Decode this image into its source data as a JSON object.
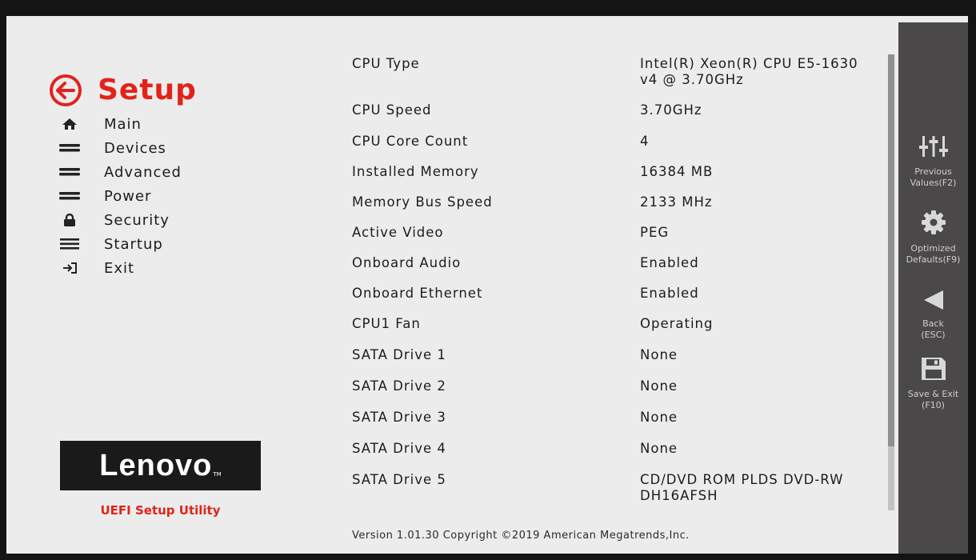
{
  "header": {
    "title": "Setup"
  },
  "nav": {
    "items": [
      {
        "label": "Main",
        "icon": "home-icon"
      },
      {
        "label": "Devices",
        "icon": "devices-icon"
      },
      {
        "label": "Advanced",
        "icon": "advanced-icon"
      },
      {
        "label": "Power",
        "icon": "power-icon"
      },
      {
        "label": "Security",
        "icon": "lock-icon"
      },
      {
        "label": "Startup",
        "icon": "startup-icon"
      },
      {
        "label": "Exit",
        "icon": "exit-icon"
      }
    ]
  },
  "brand": {
    "logo_text": "Lenovo",
    "logo_tm": "TM",
    "utility_label": "UEFI Setup Utility",
    "accent_color": "#e2231a"
  },
  "info": [
    {
      "label": "CPU Type",
      "value": "Intel(R) Xeon(R) CPU E5-1630 v4 @ 3.70GHz"
    },
    {
      "label": "CPU Speed",
      "value": "3.70GHz"
    },
    {
      "label": "CPU Core Count",
      "value": "4"
    },
    {
      "label": "Installed Memory",
      "value": "16384 MB"
    },
    {
      "label": "Memory Bus Speed",
      "value": "2133 MHz"
    },
    {
      "label": "Active Video",
      "value": "PEG"
    },
    {
      "label": "Onboard Audio",
      "value": "Enabled"
    },
    {
      "label": "Onboard Ethernet",
      "value": "Enabled"
    },
    {
      "label": "CPU1 Fan",
      "value": "Operating"
    },
    {
      "label": "SATA Drive 1",
      "value": "None"
    },
    {
      "label": "SATA Drive 2",
      "value": "None"
    },
    {
      "label": "SATA Drive 3",
      "value": "None"
    },
    {
      "label": "SATA Drive 4",
      "value": "None"
    },
    {
      "label": "SATA Drive 5",
      "value": "CD/DVD ROM PLDS DVD-RW DH16AFSH"
    }
  ],
  "footer": {
    "text": "Version 1.01.30 Copyright ©2019 American Megatrends,Inc."
  },
  "functions": [
    {
      "label": "Previous\nValues(F2)",
      "icon": "sliders-icon"
    },
    {
      "label": "Optimized\nDefaults(F9)",
      "icon": "gear-icon"
    },
    {
      "label": "Back\n(ESC)",
      "icon": "back-arrow-icon"
    },
    {
      "label": "Save & Exit\n(F10)",
      "icon": "save-icon"
    }
  ]
}
